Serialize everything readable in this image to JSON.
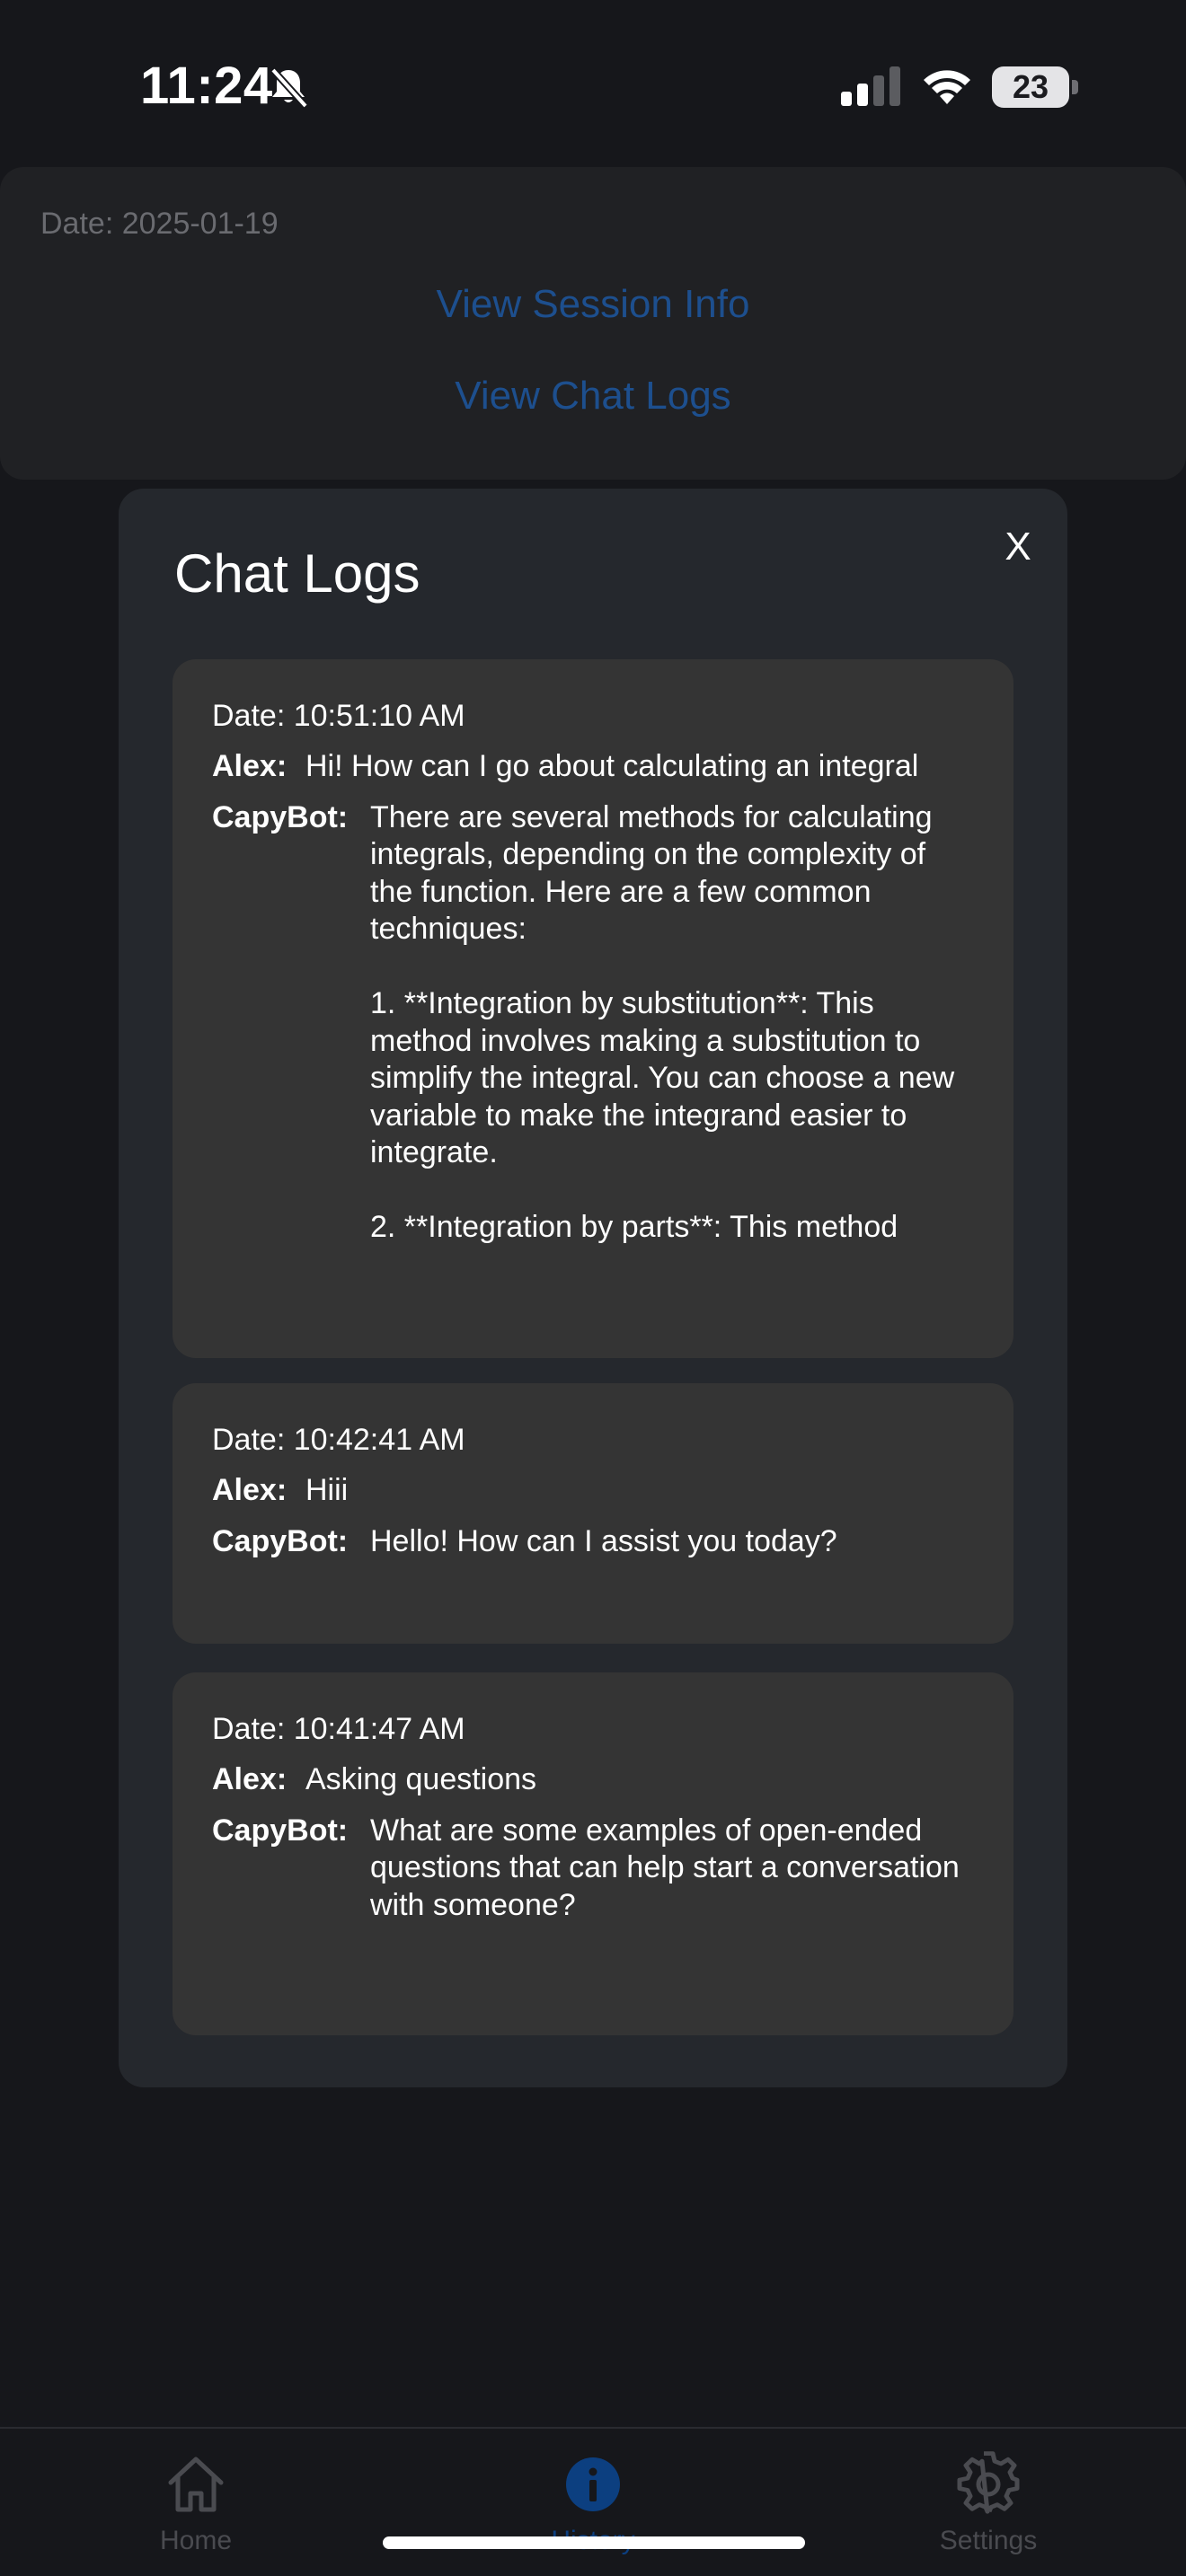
{
  "status_bar": {
    "time": "11:24",
    "battery": "23",
    "icons": [
      "bell-slash-icon",
      "signal-icon",
      "wifi-icon",
      "battery-icon"
    ]
  },
  "background": {
    "date": "Date: 2025-01-19",
    "view_session_info": "View Session Info",
    "view_chat_logs": "View Chat Logs"
  },
  "modal": {
    "title": "Chat Logs",
    "close_label": "X",
    "logs": [
      {
        "date": "Date: 10:51:10 AM",
        "user_label": "Alex:",
        "user_message": "Hi! How can I go about calculating an integral",
        "bot_label": "CapyBot:",
        "bot_message": "There are several methods for calculating integrals, depending on the complexity of the function. Here are a few common techniques:\n\n1. **Integration by substitution**: This method involves making a substitution to simplify the integral. You can choose a new variable to make the integrand easier to integrate.\n\n2. **Integration by parts**: This method involves breaking down the integrand"
      },
      {
        "date": "Date: 10:42:41 AM",
        "user_label": "Alex:",
        "user_message": "Hiii",
        "bot_label": "CapyBot:",
        "bot_message": "Hello! How can I assist you today?"
      },
      {
        "date": "Date: 10:41:47 AM",
        "user_label": "Alex:",
        "user_message": "Asking questions",
        "bot_label": "CapyBot:",
        "bot_message": "What are some examples of open-ended questions that can help start a conversation with someone?"
      }
    ]
  },
  "tab_bar": {
    "tabs": [
      {
        "label": "Home",
        "icon": "home-icon"
      },
      {
        "label": "History",
        "icon": "info-icon",
        "active": true
      },
      {
        "label": "Settings",
        "icon": "gear-icon"
      }
    ]
  },
  "colors": {
    "background": "#16171b",
    "modal": "#25282d",
    "card": "#343434",
    "link_dimmed": "#1d4f8e",
    "active_tab": "#0c3f80"
  }
}
